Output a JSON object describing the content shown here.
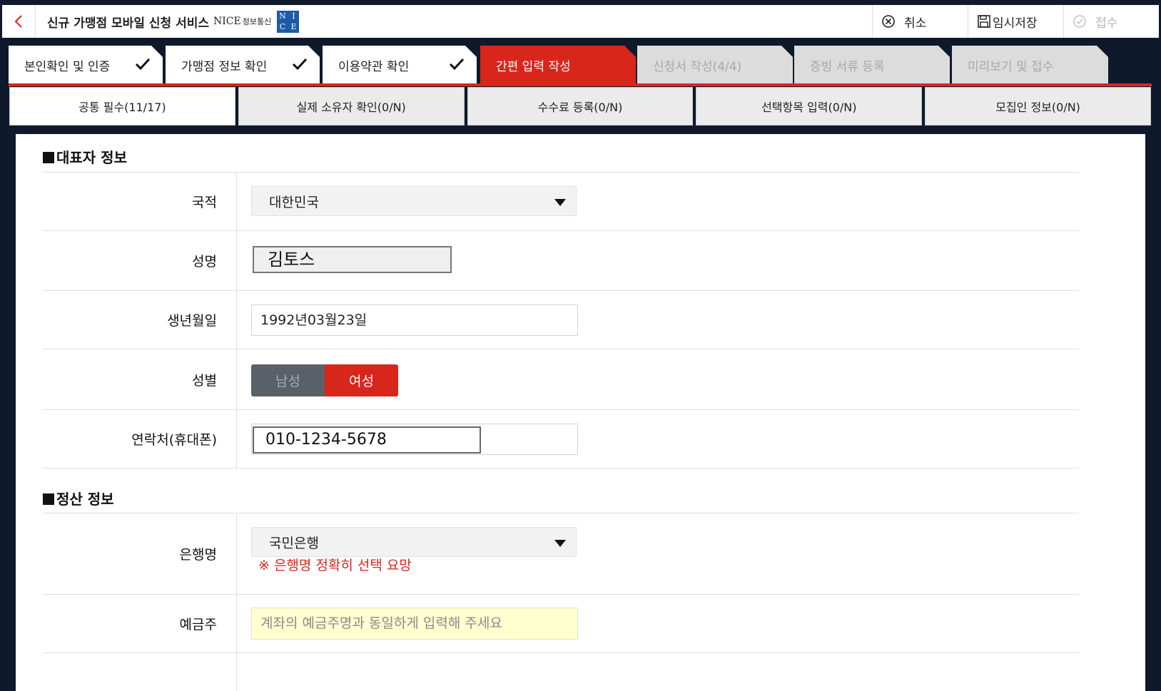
{
  "header": {
    "title": "신규 가맹점 모바일 신청 서비스",
    "brand": "NICE",
    "brand_sub": "정보통신",
    "logo_letters": [
      "N",
      "I",
      "C",
      "E"
    ],
    "actions": [
      {
        "label": "취소",
        "icon": "cancel-circle-icon"
      },
      {
        "label": "임시저장",
        "icon": "save-icon"
      },
      {
        "label": "접수",
        "icon": "check-circle-icon",
        "disabled": true
      }
    ]
  },
  "steps": [
    {
      "label": "본인확인 및 인증",
      "state": "done"
    },
    {
      "label": "가맹점 정보 확인",
      "state": "done"
    },
    {
      "label": "이용약관 확인",
      "state": "done"
    },
    {
      "label": "간편 입력 작성",
      "state": "active"
    },
    {
      "label": "신청서 작성(4/4)",
      "state": "inactive"
    },
    {
      "label": "증빙 서류 등록",
      "state": "inactive"
    },
    {
      "label": "미리보기 및 접수",
      "state": "inactive"
    }
  ],
  "subtabs": [
    {
      "label": "공통 필수(11/17)",
      "active": true
    },
    {
      "label": "실제 소유자 확인(0/N)"
    },
    {
      "label": "수수료 등록(0/N)"
    },
    {
      "label": "선택항목 입력(0/N)"
    },
    {
      "label": "모집인 정보(0/N)"
    }
  ],
  "rep": {
    "title": "대표자 정보",
    "nationality_label": "국적",
    "nationality_value": "대한민국",
    "name_label": "성명",
    "name_value": "김토스",
    "birth_label": "생년월일",
    "birth_value": "1992년03월23일",
    "gender_label": "성별",
    "gender_male": "남성",
    "gender_female": "여성",
    "phone_label": "연락처(휴대폰)",
    "phone_value": "010-1234-5678"
  },
  "settle": {
    "title": "정산 정보",
    "bank_label": "은행명",
    "bank_value": "국민은행",
    "bank_warning": "※ 은행명 정확히 선택 요망",
    "holder_label": "예금주",
    "holder_placeholder": "계좌의 예금주명과 동일하게 입력해 주세요"
  },
  "colors": {
    "accent": "#d9261c",
    "background": "#0e1a2b",
    "brand_blue": "#1d5aa8"
  }
}
